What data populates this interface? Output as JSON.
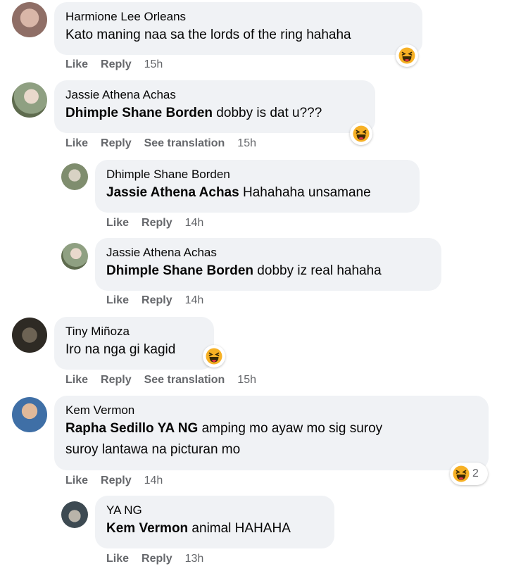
{
  "comments": [
    {
      "author": "Harmione Lee Orleans",
      "mention": "",
      "text": "Kato maning naa sa the lords of the ring hahaha",
      "like": "Like",
      "reply": "Reply",
      "translate": "",
      "time": "15h",
      "reaction_icon": "haha-emoji",
      "reaction_count": ""
    },
    {
      "author": "Jassie Athena Achas",
      "mention": "Dhimple Shane Borden",
      "text": " dobby is dat u???",
      "like": "Like",
      "reply": "Reply",
      "translate": "See translation",
      "time": "15h",
      "reaction_icon": "haha-emoji",
      "reaction_count": ""
    },
    {
      "author": "Dhimple Shane Borden",
      "mention": "Jassie Athena Achas",
      "text": " Hahahaha unsamane",
      "like": "Like",
      "reply": "Reply",
      "translate": "",
      "time": "14h"
    },
    {
      "author": "Jassie Athena Achas",
      "mention": "Dhimple Shane Borden",
      "text": " dobby iz real hahaha",
      "like": "Like",
      "reply": "Reply",
      "translate": "",
      "time": "14h"
    },
    {
      "author": "Tiny Miñoza",
      "mention": "",
      "text": "Iro na nga gi kagid",
      "like": "Like",
      "reply": "Reply",
      "translate": "See translation",
      "time": "15h",
      "reaction_icon": "haha-emoji",
      "reaction_count": ""
    },
    {
      "author": "Kem Vermon",
      "mention": "Rapha Sedillo YA NG",
      "text": " amping mo ayaw mo sig suroy",
      "text2": "suroy lantawa na picturan mo",
      "like": "Like",
      "reply": "Reply",
      "translate": "",
      "time": "14h",
      "reaction_icon": "haha-emoji",
      "reaction_count": "2"
    },
    {
      "author": "YA NG",
      "mention": "Kem Vermon",
      "text": " animal HAHAHA",
      "like": "Like",
      "reply": "Reply",
      "translate": "",
      "time": "13h"
    }
  ],
  "colors": {
    "bubble": "#f0f2f5",
    "meta": "#65676b",
    "haha": "#f7b125"
  }
}
